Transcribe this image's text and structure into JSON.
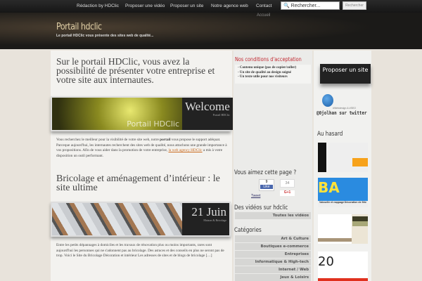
{
  "nav": {
    "items": [
      "Rédaction by HDClic",
      "Proposer une vidéo",
      "Proposer un site",
      "Notre agence web",
      "Contact"
    ],
    "sub_item": "Accueil",
    "search_placeholder": "Rechercher...",
    "search_button": "Rechercher"
  },
  "header": {
    "title": "Portail hdclic",
    "tagline": "Le portail HDClic vous présente des sites web de qualité..."
  },
  "intro": {
    "title": "Sur le portail HDClic, vous avez la possibilité de présenter votre entreprise et votre site aux internautes.",
    "banner_watermark": "Portail HDClic",
    "banner_title": "Welcome",
    "banner_sub": "Portail HDClic",
    "text_before": "Vous recherchez le meilleur pour la visibilité de votre site web, notre ",
    "text_bold": "portail",
    "text_mid": " vous propose le support adéquat. Parceque aujourd'hui, les internautes recherchent des sites web de qualité, nous attachons une grande importance à vos propositions. Afin de vous aider dans la promotion de votre entreprise, ",
    "link": "la web agency HDClic",
    "text_after": " a mis à votre disposition un outil performant."
  },
  "article": {
    "title": "Bricolage et aménagement d’intérieur : le site ultime",
    "date": "21 Juin",
    "category": "Maison & Bricolage",
    "excerpt": "Entre les petits dépannages à domiciles et les travaux de rénovation plus ou moins importants, rares sont aujourd'hui les personnes qui ne s'adonnent pas au bricolage. Des astuces et des conseils en plus ne seront pas de trop. Voici le Site du Bricolage Décoration et intérieur Les adresses de sites et de blogs de bricolage […]"
  },
  "conditions": {
    "title": "Nos conditions d'acceptation",
    "items": [
      "- Contenu unique (pas de copier/coller)",
      "- Un site de qualité au design soigné",
      "- Un texte utile pour nos visiteurs"
    ]
  },
  "social": {
    "title": "Vous aimez cette page ?",
    "like_count": "9",
    "like_label": "Like",
    "gplus_count": "34",
    "gplus_label": "G+1",
    "tweet": "Tweet"
  },
  "videos": {
    "title": "Des vidéos sur hdclic",
    "link": "Toutes les vidéos"
  },
  "categories": {
    "title": "Catégories",
    "items": [
      "Art & Culture",
      "Boutiques e-commerce",
      "Entreprises",
      "Informatique & High-tech",
      "Internet / Web",
      "Jeux & Loisirs"
    ]
  },
  "right": {
    "propose": "Proposer un site",
    "twitter": "@0jolhan sur twitter",
    "twitter_sub": "#Webdesign & #SEO",
    "random_title": "Au hasard",
    "thumb2_labels": [
      "Vaisselle et nappage",
      "Décoration de fête"
    ]
  },
  "colors": {
    "accent_red": "#c0262f",
    "link": "#c96a1d"
  }
}
